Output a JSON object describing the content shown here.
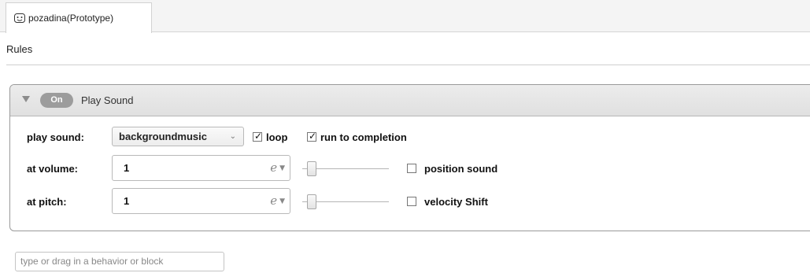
{
  "tab": {
    "icon": "face-icon",
    "title": "pozadina(Prototype)"
  },
  "rules_label": "Rules",
  "behavior": {
    "collapse_icon": "triangle-down-icon",
    "toggle_label": "On",
    "title": "Play Sound",
    "play_sound_label": "play sound:",
    "sound_value": "backgroundmusic",
    "sound_dropdown_icon": "chevron-down-icon",
    "loop": {
      "label": "loop",
      "checked": true
    },
    "run_to_completion": {
      "label": "run to completion",
      "checked": true
    },
    "volume_label": "at volume:",
    "volume_value": "1",
    "volume_expr_glyph": "e",
    "volume_level": 0.0,
    "position_sound": {
      "label": "position sound",
      "checked": false
    },
    "pitch_label": "at pitch:",
    "pitch_value": "1",
    "pitch_expr_glyph": "e",
    "pitch_level": 0.0,
    "velocity_shift": {
      "label": "velocity Shift",
      "checked": false
    }
  },
  "add_behavior_placeholder": "type or drag in a behavior or block"
}
